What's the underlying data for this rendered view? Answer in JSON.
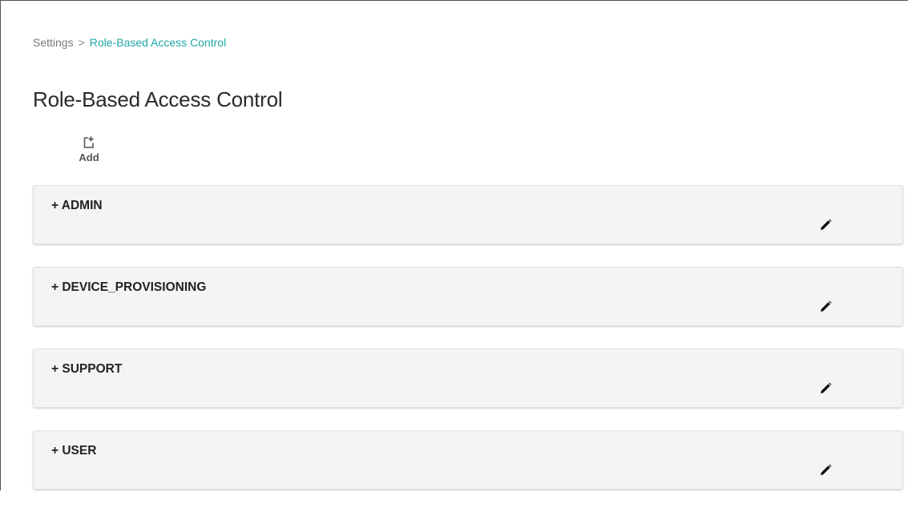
{
  "breadcrumb": {
    "parent": "Settings",
    "separator": ">",
    "current": "Role-Based Access Control"
  },
  "page": {
    "title": "Role-Based Access Control"
  },
  "toolbar": {
    "add_label": "Add",
    "add_icon": "add-document-icon"
  },
  "roles": [
    {
      "label": "+ ADMIN",
      "edit_icon": "pencil-icon"
    },
    {
      "label": "+ DEVICE_PROVISIONING",
      "edit_icon": "pencil-icon"
    },
    {
      "label": "+ SUPPORT",
      "edit_icon": "pencil-icon"
    },
    {
      "label": "+ USER",
      "edit_icon": "pencil-icon"
    }
  ],
  "colors": {
    "accent": "#1fa6a6",
    "card_background": "#f4f4f4",
    "text": "#222222",
    "muted_text": "#7a7a7a"
  }
}
